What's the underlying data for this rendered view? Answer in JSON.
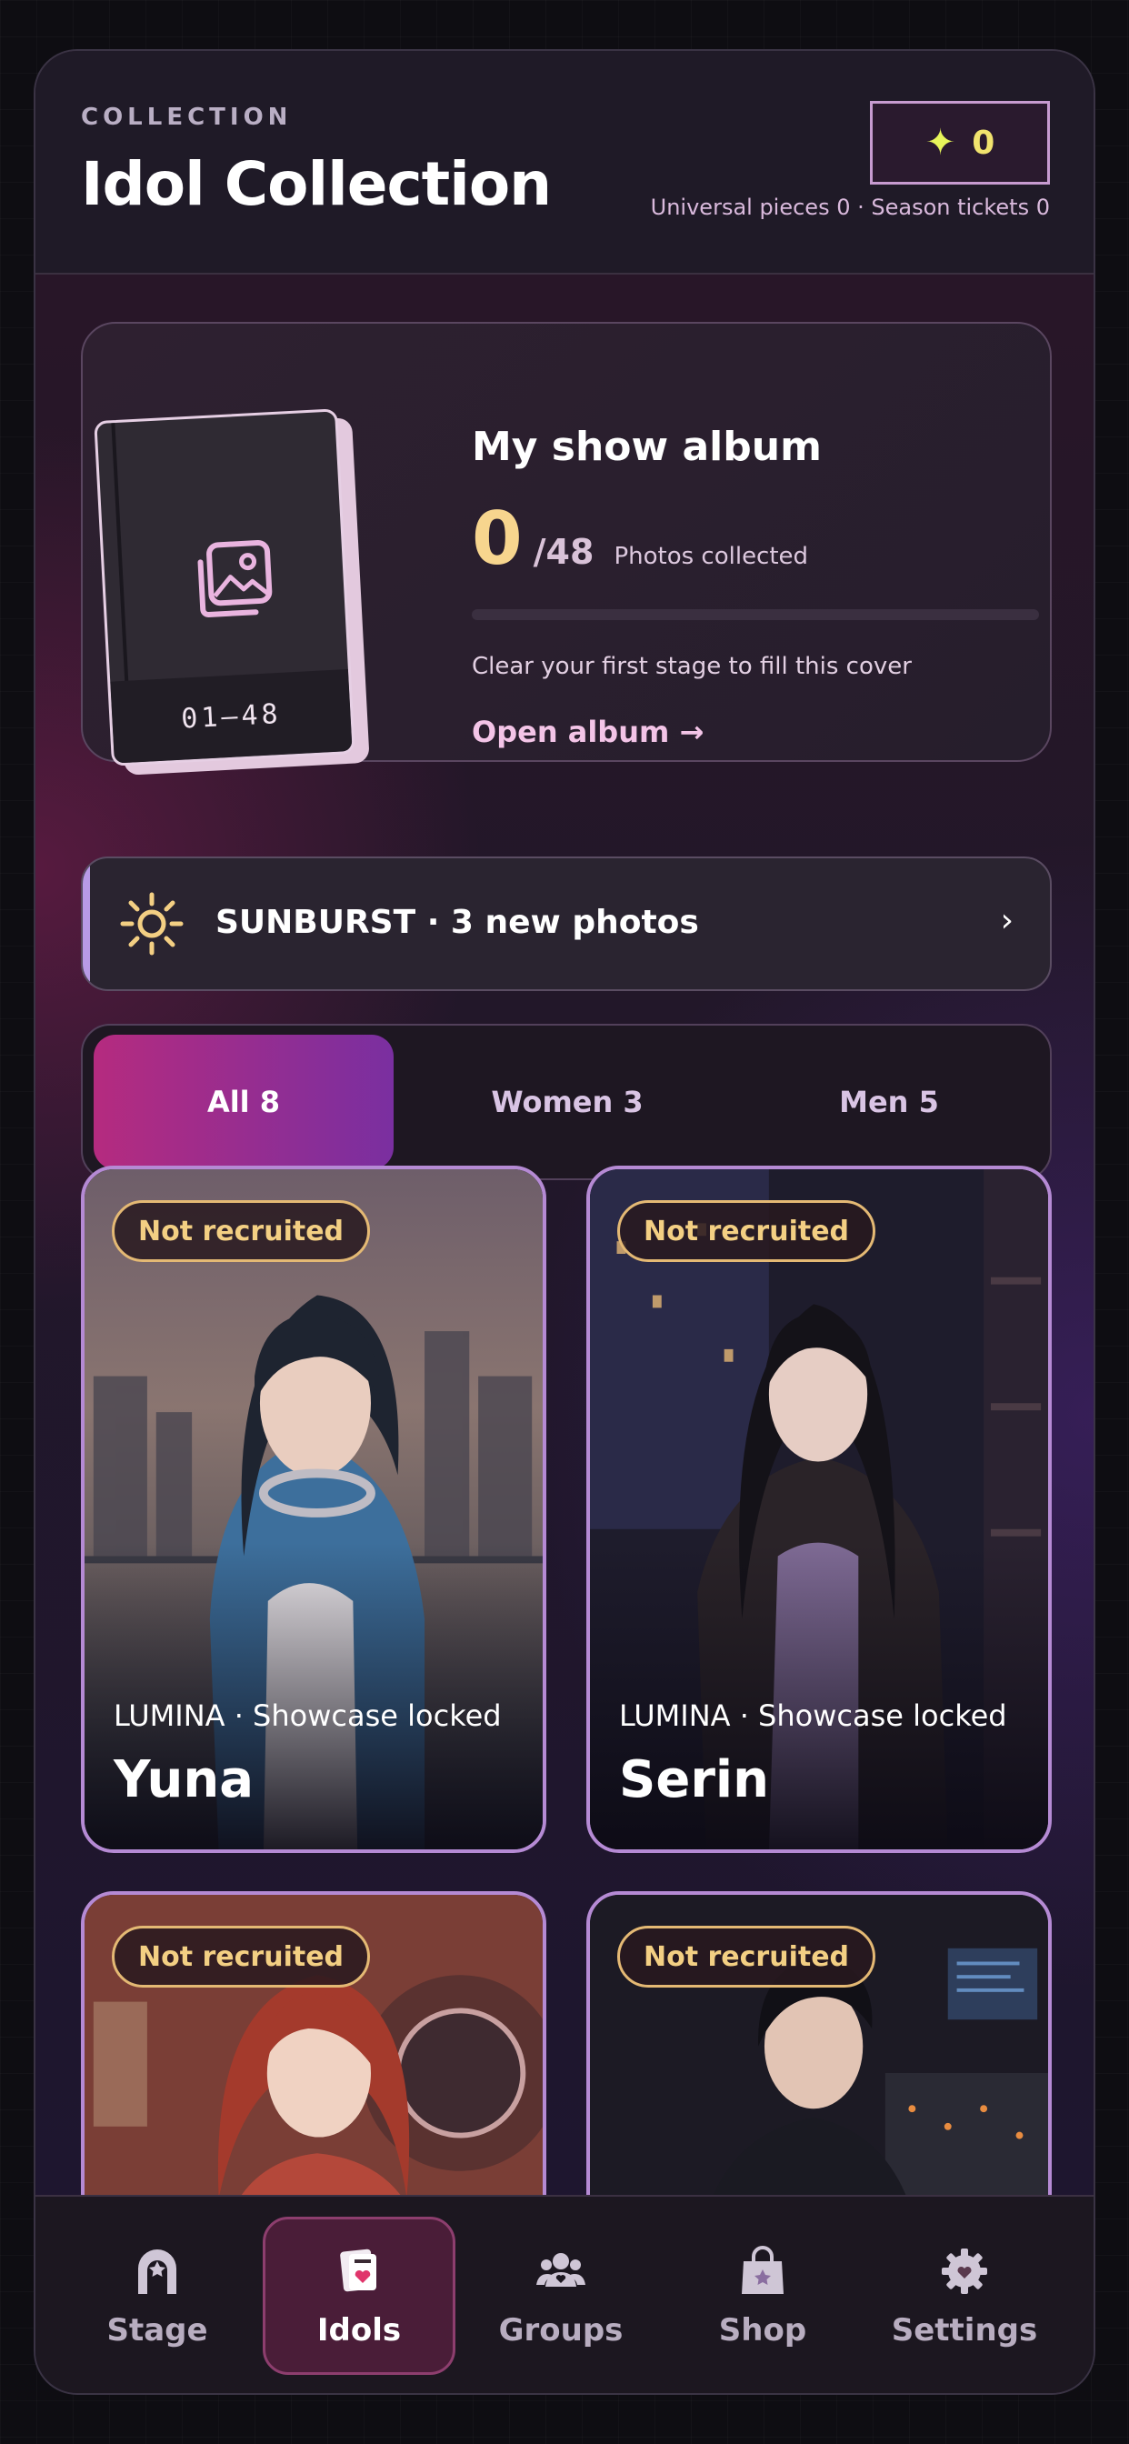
{
  "header": {
    "eyebrow": "COLLECTION",
    "title": "Idol Collection",
    "stars": "0",
    "subtitle": "Universal pieces 0 · Season tickets 0"
  },
  "album": {
    "book_label": "01—48",
    "title": "My show album",
    "collected": "0",
    "total": "/48",
    "collected_label": "Photos collected",
    "progress": 0,
    "hint": "Clear your first stage to fill this cover",
    "link": "Open album →"
  },
  "banner": {
    "text": "SUNBURST · 3 new photos",
    "chevron": "›"
  },
  "filters": [
    {
      "label": "All 8",
      "active": true
    },
    {
      "label": "Women 3",
      "active": false
    },
    {
      "label": "Men 5",
      "active": false
    }
  ],
  "idols": [
    {
      "badge": "Not recruited",
      "meta": "LUMINA · Showcase locked",
      "name": "Yuna"
    },
    {
      "badge": "Not recruited",
      "meta": "LUMINA · Showcase locked",
      "name": "Serin"
    },
    {
      "badge": "Not recruited"
    },
    {
      "badge": "Not recruited"
    }
  ],
  "tabs": [
    {
      "label": "Stage",
      "icon": "stage-icon"
    },
    {
      "label": "Idols",
      "icon": "idols-icon",
      "active": true
    },
    {
      "label": "Groups",
      "icon": "groups-icon"
    },
    {
      "label": "Shop",
      "icon": "shop-icon"
    },
    {
      "label": "Settings",
      "icon": "settings-icon"
    }
  ],
  "colors": {
    "accent_pink": "#b52b7f",
    "accent_purple": "#7a2fa0",
    "badge_gold": "#f3cf83",
    "star": "#e7f55a"
  }
}
